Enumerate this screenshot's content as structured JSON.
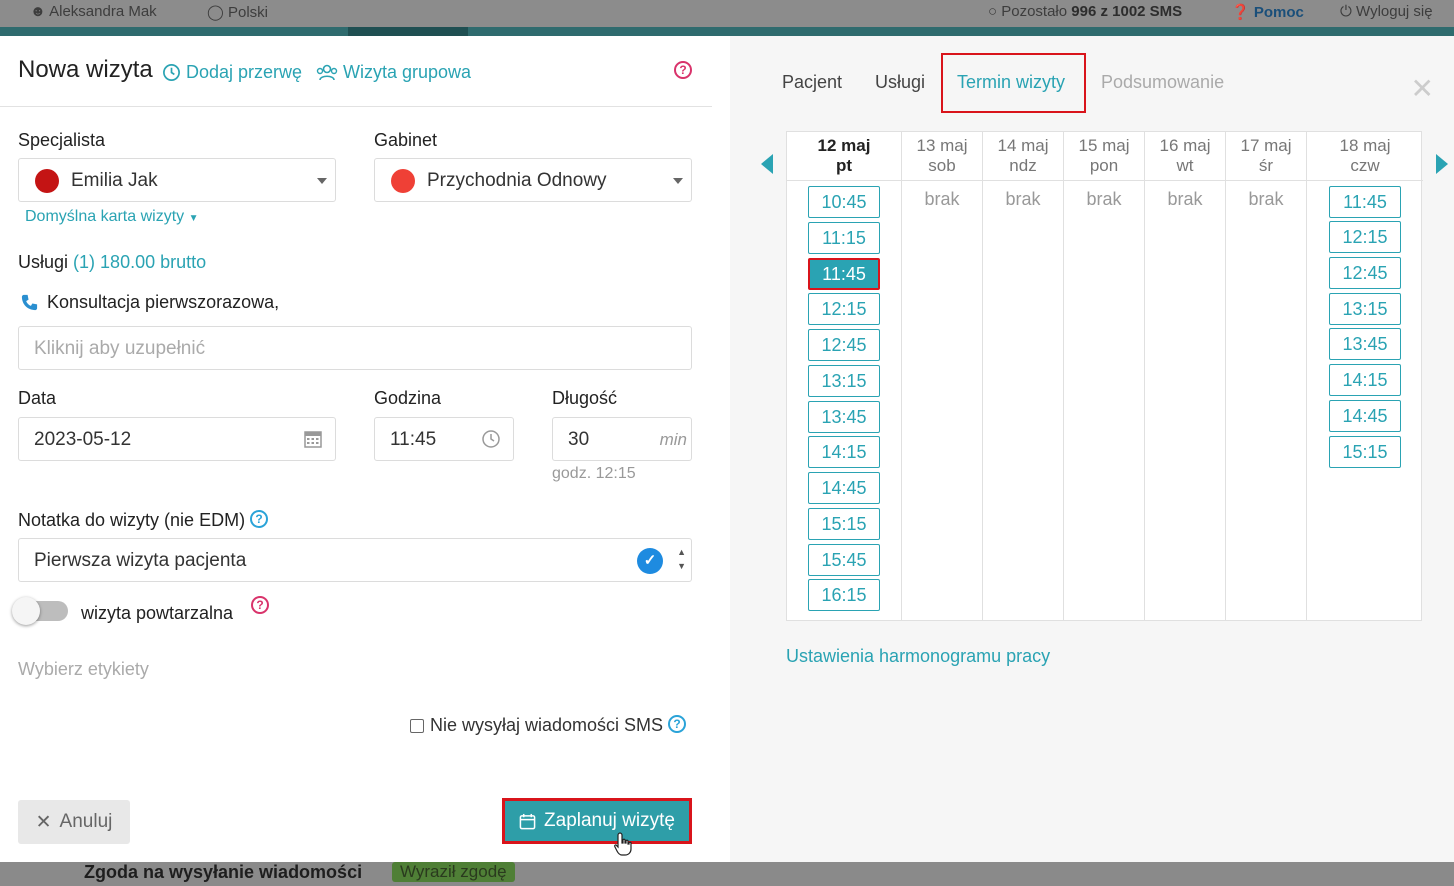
{
  "topbar": {
    "user": "Aleksandra Mak",
    "language": "Polski",
    "sms_prefix": "Pozostało",
    "sms_count": "996 z 1002 SMS",
    "help": "Pomoc",
    "logout": "Wyloguj się"
  },
  "background": {
    "consent_label": "Zgoda na wysyłanie wiadomości",
    "consent_badge": "Wyraził zgodę"
  },
  "header": {
    "title": "Nowa wizyta",
    "add_break": "Dodaj przerwę",
    "group_visit": "Wizyta grupowa",
    "help_icon": "?"
  },
  "form": {
    "specialist_label": "Specjalista",
    "specialist_value": "Emilia Jak",
    "specialist_color": "#c41414",
    "office_label": "Gabinet",
    "office_value": "Przychodnia Odnowy",
    "office_color": "#ef4036",
    "default_card": "Domyślna karta wizyty",
    "services_label": "Usługi",
    "services_summary": "(1) 180.00 brutto",
    "service_item": "Konsultacja pierwszorazowa,",
    "service_input_placeholder": "Kliknij aby uzupełnić",
    "date_label": "Data",
    "date_value": "2023-05-12",
    "time_label": "Godzina",
    "time_value": "11:45",
    "length_label": "Długość",
    "length_value": "30",
    "length_unit": "min",
    "end_time": "godz. 12:15",
    "note_label": "Notatka do wizyty (nie EDM)",
    "note_value": "Pierwsza wizyta pacjenta",
    "recurring_label": "wizyta powtarzalna",
    "tags_placeholder": "Wybierz etykiety",
    "no_sms_label": "Nie wysyłaj wiadomości SMS"
  },
  "footer": {
    "cancel": "Anuluj",
    "schedule": "Zaplanuj wizytę"
  },
  "tabs": [
    "Pacjent",
    "Usługi",
    "Termin wizyty",
    "Podsumowanie"
  ],
  "calendar": {
    "days": [
      {
        "date": "12 maj",
        "weekday": "pt",
        "selected": true,
        "slots": [
          "10:45",
          "11:15",
          "11:45",
          "12:15",
          "12:45",
          "13:15",
          "13:45",
          "14:15",
          "14:45",
          "15:15",
          "15:45",
          "16:15"
        ],
        "selected_slot": "11:45"
      },
      {
        "date": "13 maj",
        "weekday": "sob",
        "empty": "brak"
      },
      {
        "date": "14 maj",
        "weekday": "ndz",
        "empty": "brak"
      },
      {
        "date": "15 maj",
        "weekday": "pon",
        "empty": "brak"
      },
      {
        "date": "16 maj",
        "weekday": "wt",
        "empty": "brak"
      },
      {
        "date": "17 maj",
        "weekday": "śr",
        "empty": "brak"
      },
      {
        "date": "18 maj",
        "weekday": "czw",
        "slots": [
          "11:45",
          "12:15",
          "12:45",
          "13:15",
          "13:45",
          "14:15",
          "14:45",
          "15:15"
        ]
      }
    ],
    "schedule_settings": "Ustawienia harmonogramu pracy"
  }
}
